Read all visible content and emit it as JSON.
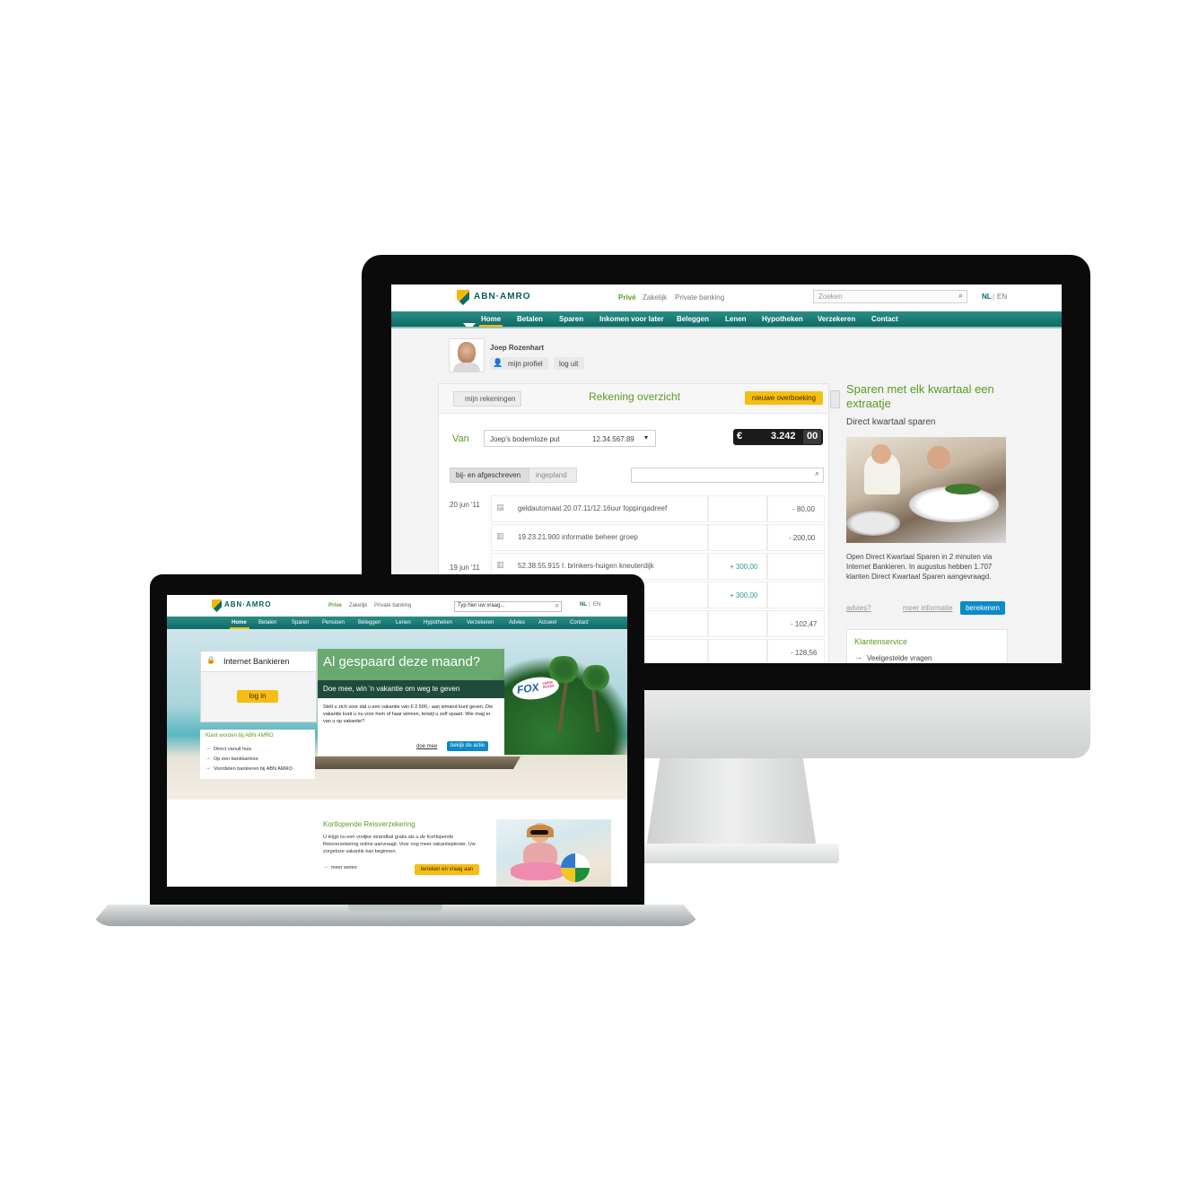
{
  "imac": {
    "logo": "ABN·AMRO",
    "segments": [
      "Privé",
      "Zakelijk",
      "Private banking"
    ],
    "search_placeholder": "Zoeken",
    "lang_nl": "NL",
    "lang_sep": "|",
    "lang_en": "EN",
    "nav": [
      "Home",
      "Betalen",
      "Sparen",
      "Inkomen voor later",
      "Beleggen",
      "Lenen",
      "Hypotheken",
      "Verzekeren",
      "Contact"
    ],
    "user": {
      "name": "Joep Rozenhart",
      "profile": "mijn profiel",
      "logout": "log uit"
    },
    "overview": {
      "back": "mijn rekeningen",
      "title": "Rekening overzicht",
      "new_transfer": "nieuwe overboeking",
      "van_label": "Van",
      "account_name": "Joep's bodemloze put",
      "account_number": "12.34.567.89",
      "currency": "€",
      "balance_whole": "3.242",
      "balance_cents": "00",
      "tab_booked": "bij- en afgeschreven",
      "tab_planned": "ingepland",
      "transactions": [
        {
          "date": "20 jun '11",
          "desc": "geldautomaat 20.07.11/12.16uur foppingadreef",
          "credit": "",
          "debit": "- 80,00"
        },
        {
          "date": "",
          "desc": "19.23.21.900 informatie beheer groep",
          "credit": "",
          "debit": "- 200,00"
        },
        {
          "date": "19 jun '11",
          "desc": "52.38.55.915 I. brinkers-huigen kneuterdijk",
          "credit": "+ 300,00",
          "debit": ""
        },
        {
          "date": "",
          "desc": "",
          "credit": "+ 300,00",
          "debit": ""
        },
        {
          "date": "",
          "desc": "",
          "credit": "",
          "debit": "- 102,47"
        },
        {
          "date": "",
          "desc": "",
          "credit": "",
          "debit": "- 128,56"
        }
      ]
    },
    "promo": {
      "title": "Sparen met elk kwartaal een extraatje",
      "subtitle": "Direct kwartaal sparen",
      "text": "Open Direct Kwartaal Sparen in 2 minuten via Internet Bankieren. In augustus hebben 1.707 klanten Direct Kwartaal Sparen aangevraagd.",
      "advice": "advies?",
      "more": "meer informatie",
      "calculate": "berekenen"
    },
    "service": {
      "title": "Klantenservice",
      "faq": "Veelgestelde vragen"
    }
  },
  "laptop": {
    "logo": "ABN·AMRO",
    "segments": [
      "Prive",
      "Zakelijk",
      "Private banking"
    ],
    "search_placeholder": "Typ hier uw vraag...",
    "lang_nl": "NL",
    "lang_sep": "|",
    "lang_en": "EN",
    "nav": [
      "Home",
      "Betalen",
      "Sparen",
      "Pensioen",
      "Beleggen",
      "Lenen",
      "Hypotheken",
      "Verzekeren",
      "Advies",
      "Actueel",
      "Contact"
    ],
    "login": {
      "title": "Internet Bankieren",
      "button": "log in"
    },
    "become_client": {
      "title": "Klant worden bij ABN AMRO",
      "items": [
        "Direct vanuit huis",
        "Op een bankkantoor",
        "Voordelen bankieren bij ABN AMRO"
      ]
    },
    "campaign": {
      "headline": "Al gespaard deze maand?",
      "sub": "Doe mee, win 'n vakantie om weg te geven",
      "text": "Stelt u zich voor dat u een vakantie van € 2.500,- aan iemand kunt geven. Die vakantie kunt u nu voor hem of haar winnen, terwijl u zelf spaart. Wie mag er van u op vakantie?",
      "join": "doe mee",
      "view": "bekijk de actie",
      "badge": "FOX",
      "badge_sub": "VERRE REIZEN"
    },
    "travel": {
      "title": "Kortlopende Reisverzekering",
      "text": "U krijgt nu een vrolijke strandbal gratis als u de Kortlopende Reisverzekering online aanvraagt. Voor nog meer vakantieplezier. Uw zorgeloze vakantie kan beginnen.",
      "more": "meer weten",
      "calc": "bereken en vraag aan"
    }
  },
  "colors": {
    "brand_green": "#0c6c68",
    "brand_yellow": "#f5b800",
    "accent_green": "#5b9a22",
    "link_blue": "#0c8ac6"
  },
  "icons": [
    "search-icon",
    "user-icon",
    "arrow-icon",
    "dropdown-icon",
    "atm-icon",
    "building-icon",
    "lock-icon"
  ]
}
